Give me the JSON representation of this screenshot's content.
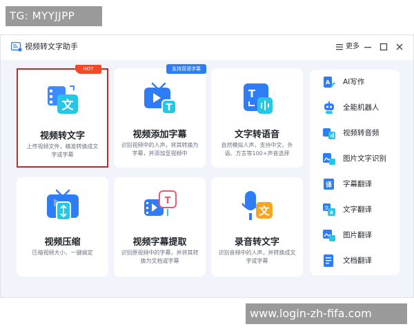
{
  "watermark_top": "TG: MYYJJPP",
  "watermark_bottom": "www.login-zh-fifa.com",
  "window": {
    "title": "视频转文字助手",
    "menu_label": "更多",
    "minimize_symbol": "—",
    "maximize_symbol": "□",
    "close_symbol": "×"
  },
  "tools": [
    {
      "title": "视频转文字",
      "desc": "上传视频文件，精准转换成文字或字幕",
      "badge": "HOT",
      "icon": "video-to-text-icon"
    },
    {
      "title": "视频添加字幕",
      "desc": "识别视频中的人声，将其转换为字幕，并添加至视频中",
      "badge": "支持双语字幕",
      "icon": "add-subtitle-icon"
    },
    {
      "title": "文字转语音",
      "desc": "自然模拟人声，支持中文、外语、方言等100+声音选择",
      "badge": "",
      "icon": "text-to-speech-icon"
    },
    {
      "title": "视频压缩",
      "desc": "压缩视频大小，一键搞定",
      "badge": "",
      "icon": "video-compress-icon"
    },
    {
      "title": "视频字幕提取",
      "desc": "识别原视频中的字幕，并将其转换为文档或字幕",
      "badge": "",
      "icon": "subtitle-extract-icon"
    },
    {
      "title": "录音转文字",
      "desc": "识别音频中的人声，并转换成文字或字幕",
      "badge": "",
      "icon": "audio-to-text-icon"
    }
  ],
  "sidebar": {
    "items": [
      {
        "label": "AI写作",
        "icon": "ai-writing-icon"
      },
      {
        "label": "全能机器人",
        "icon": "robot-icon"
      },
      {
        "label": "视频转音频",
        "icon": "video-to-audio-icon"
      },
      {
        "label": "图片文字识别",
        "icon": "image-ocr-icon"
      },
      {
        "label": "字幕翻译",
        "icon": "subtitle-translate-icon"
      },
      {
        "label": "文字翻译",
        "icon": "text-translate-icon"
      },
      {
        "label": "图片翻译",
        "icon": "image-translate-icon"
      },
      {
        "label": "文档翻译",
        "icon": "document-translate-icon"
      }
    ]
  },
  "colors": {
    "accent": "#2e7cf6",
    "hot": "#ef4b2b",
    "selection": "#c62828",
    "background": "#f1f4fa"
  }
}
